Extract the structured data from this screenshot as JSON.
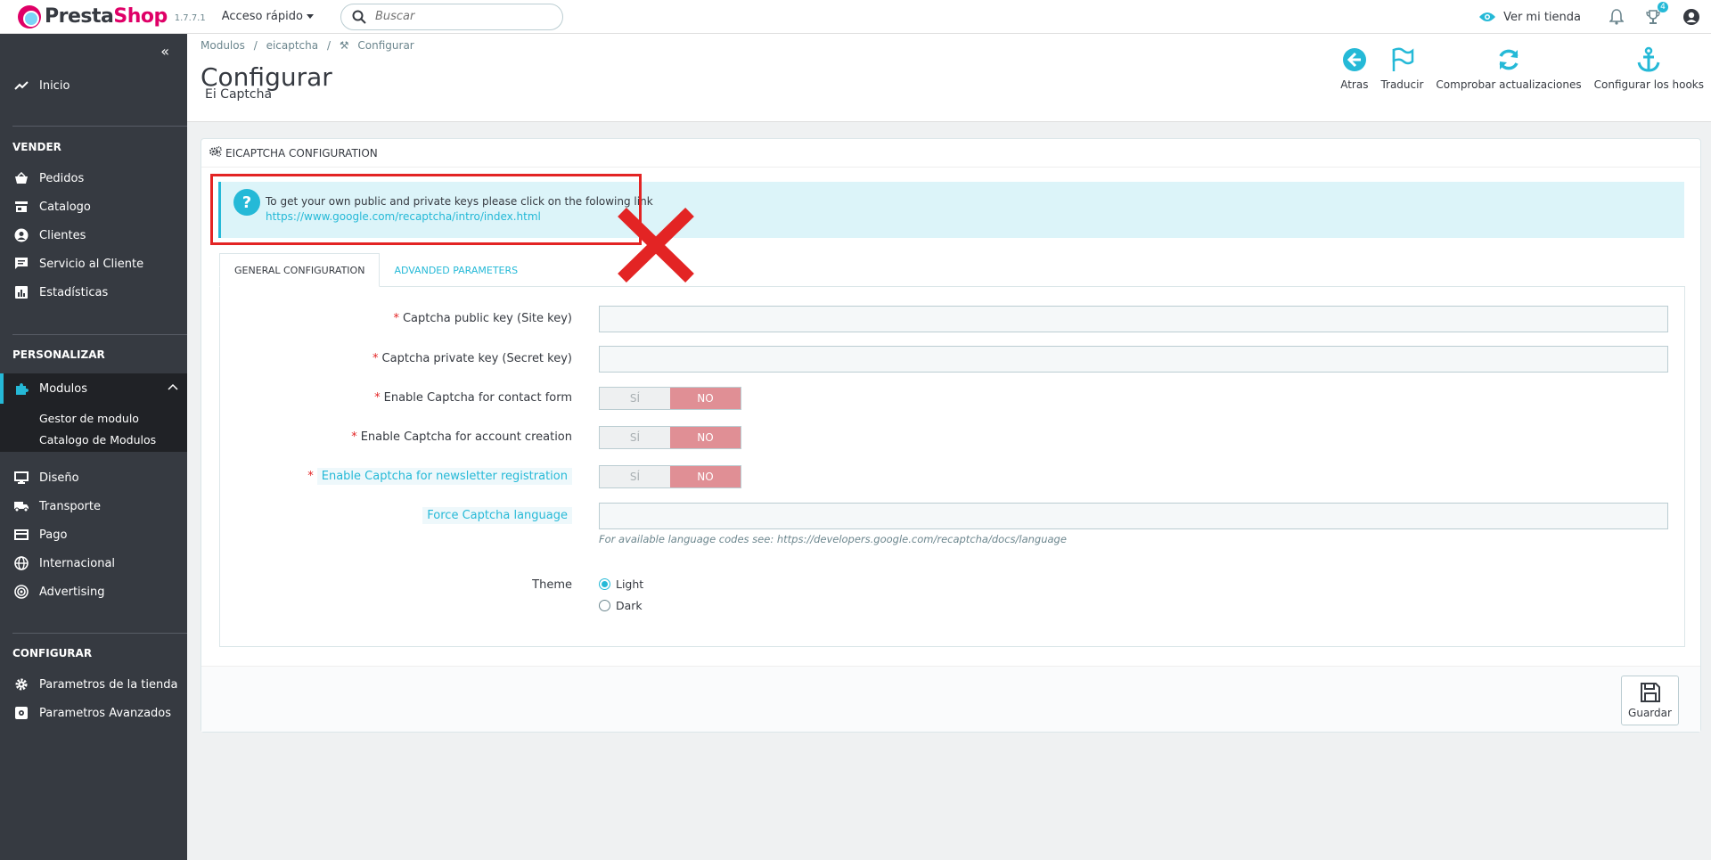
{
  "header": {
    "logo_part1": "Presta",
    "logo_part2": "Shop",
    "version": "1.7.7.1",
    "quick_access": "Acceso rápido",
    "search_placeholder": "Buscar",
    "view_shop": "Ver mi tienda",
    "trophy_badge": "4"
  },
  "sidebar": {
    "home": "Inicio",
    "section_sell": "VENDER",
    "sell_items": [
      "Pedidos",
      "Catalogo",
      "Clientes",
      "Servicio al Cliente",
      "Estadísticas"
    ],
    "section_customize": "PERSONALIZAR",
    "modules": "Modulos",
    "modules_sub": [
      "Gestor de modulo",
      "Catalogo de Modulos"
    ],
    "customize_items": [
      "Diseño",
      "Transporte",
      "Pago",
      "Internacional",
      "Advertising"
    ],
    "section_configure": "CONFIGURAR",
    "configure_items": [
      "Parametros de la tienda",
      "Parametros Avanzados"
    ]
  },
  "page": {
    "breadcrumb": [
      "Modulos",
      "/",
      "eicaptcha",
      "/",
      "Configurar"
    ],
    "title": "Configurar",
    "subtitle": "Ei Captcha",
    "toolbar": {
      "back": "Atras",
      "translate": "Traducir",
      "check_updates": "Comprobar actualizaciones",
      "hooks": "Configurar los hooks"
    }
  },
  "panel": {
    "heading": "EICAPTCHA CONFIGURATION",
    "alert_text": "To get your own public and private keys please click on the folowing link",
    "alert_link": "https://www.google.com/recaptcha/intro/index.html",
    "tabs": [
      "GENERAL CONFIGURATION",
      "ADVANDED PARAMETERS"
    ],
    "fields": {
      "public_key_label": "Captcha public key (Site key)",
      "public_key_value": "",
      "private_key_label": "Captcha private key (Secret key)",
      "private_key_value": "",
      "contact_label": "Enable Captcha for contact form",
      "account_label": "Enable Captcha for account creation",
      "newsletter_label": "Enable Captcha for newsletter registration",
      "switch_yes": "SÍ",
      "switch_no": "NO",
      "language_label": "Force Captcha language",
      "language_value": "",
      "language_help": "For available language codes see: https://developers.google.com/recaptcha/docs/language",
      "theme_label": "Theme",
      "theme_options": [
        "Light",
        "Dark"
      ]
    },
    "save": "Guardar"
  },
  "colors": {
    "brand_pink": "#df0067",
    "accent": "#25b9d7",
    "sidebar_bg": "#363a41",
    "switch_off": "#e08f95",
    "annotation_red": "#e32424"
  }
}
